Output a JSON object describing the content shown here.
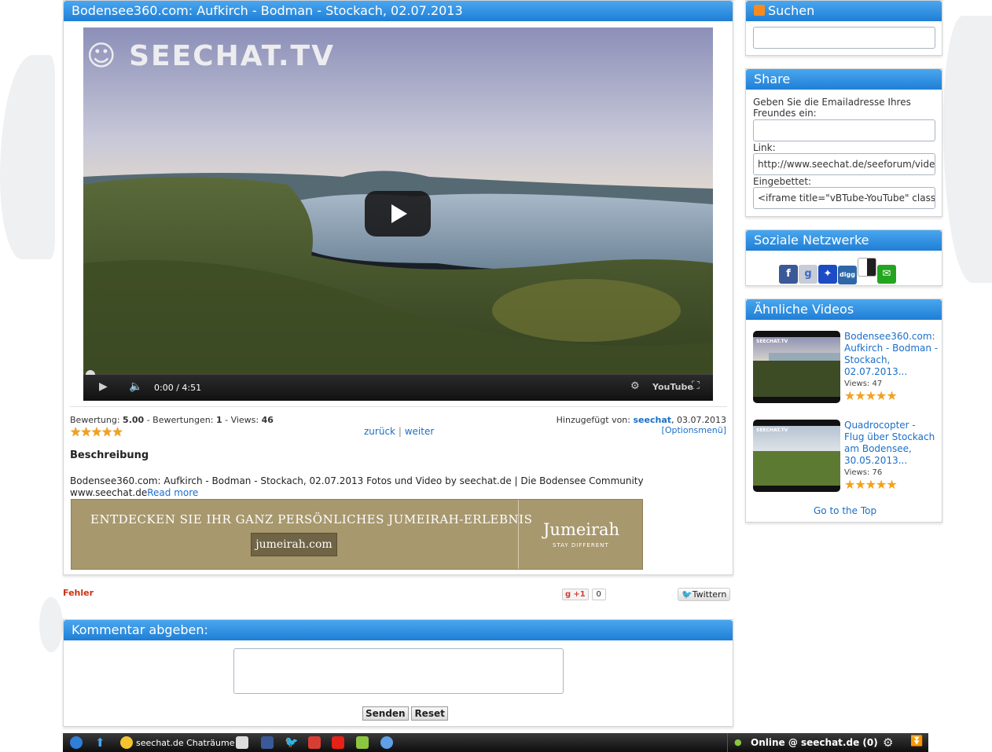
{
  "video": {
    "title": "Bodensee360.com: Aufkirch - Bodman - Stockach, 02.07.2013",
    "channel_logo": "SEECHAT.TV",
    "time_current": "0:00",
    "time_total": "4:51",
    "youtube_label": "YouTube"
  },
  "stats": {
    "rating_label": "Bewertung:",
    "rating_value": "5.00",
    "ratings_label": "- Bewertungen:",
    "ratings_value": "1",
    "views_label": "- Views:",
    "views_value": "46",
    "stars": "★★★★★",
    "back_link": "zurück",
    "separator": "|",
    "next_link": "weiter",
    "added_by_label": "Hinzugefügt von:",
    "added_by_user": "seechat",
    "added_date": ", 03.07.2013",
    "options_menu": "[Optionsmenü]"
  },
  "description": {
    "heading": "Beschreibung",
    "text": "Bodensee360.com: Aufkirch - Bodman - Stockach, 02.07.2013 Fotos und Video by seechat.de | Die Bodensee Community www.seechat.de",
    "read_more": "Read more"
  },
  "ad": {
    "headline": "ENTDECKEN SIE IHR GANZ PERSÖNLICHES JUMEIRAH-ERLEBNIS",
    "button": "jumeirah.com",
    "brand": "Jumeirah",
    "tagline": "STAY DIFFERENT"
  },
  "below": {
    "error": "Fehler",
    "plus_one": "+1",
    "plus_count": "0",
    "tweet": "Twittern"
  },
  "comment": {
    "heading": "Kommentar abgeben:",
    "send": "Senden",
    "reset": "Reset"
  },
  "sidebar": {
    "search_title": "Suchen",
    "share_title": "Share",
    "share_email_label": "Geben Sie die Emailadresse Ihres Freundes ein:",
    "share_link_label": "Link:",
    "share_link_value": "http://www.seechat.de/seeforum/videos",
    "share_embed_label": "Eingebettet:",
    "share_embed_value": "<iframe title=\"vBTube-YouTube\" class",
    "social_title": "Soziale Netzwerke",
    "social_icons": [
      "facebook-icon",
      "google-icon",
      "myspace-icon",
      "digg-icon",
      "delicious-icon",
      "chat-icon"
    ],
    "related_title": "Ähnliche Videos",
    "related": [
      {
        "title": "Bodensee360.com: Aufkirch - Bodman - Stockach, 02.07.2013...",
        "views": "Views: 47",
        "stars": "★★★★★"
      },
      {
        "title": "Quadrocopter - Flug über Stockach am Bodensee, 30.05.2013...",
        "views": "Views: 76",
        "stars": "★★★★★"
      }
    ],
    "go_top": "Go to the Top"
  },
  "taskbar": {
    "chat_rooms": "seechat.de Chaträume",
    "online": "Online @ seechat.de (0)"
  },
  "colors": {
    "accent_blue": "#1f7fd6",
    "link_blue": "#1a6fc9",
    "star": "#f4a11a",
    "error_red": "#cc3311"
  }
}
